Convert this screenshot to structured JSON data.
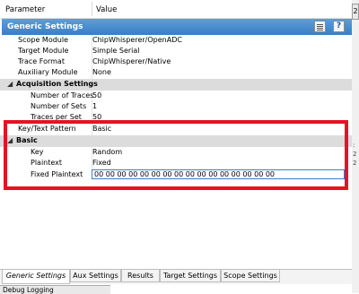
{
  "columns": {
    "parameter": "Parameter",
    "value": "Value"
  },
  "group": {
    "title": "Generic Settings"
  },
  "generic_rows": [
    {
      "key": "Scope Module",
      "value": "ChipWhisperer/OpenADC"
    },
    {
      "key": "Target Module",
      "value": "Simple Serial"
    },
    {
      "key": "Trace Format",
      "value": "ChipWhisperer/Native"
    },
    {
      "key": "Auxiliary Module",
      "value": "None"
    }
  ],
  "acq_section": {
    "label": "Acquisition Settings"
  },
  "acq_rows": [
    {
      "key": "Number of Traces",
      "value": "50"
    },
    {
      "key": "Number of Sets",
      "value": "1"
    },
    {
      "key": "Traces per Set",
      "value": "50"
    }
  ],
  "keytext_row": {
    "key": "Key/Text Pattern",
    "value": "Basic"
  },
  "basic_section": {
    "label": "Basic"
  },
  "basic_rows": [
    {
      "key": "Key",
      "value": "Random"
    },
    {
      "key": "Plaintext",
      "value": "Fixed"
    }
  ],
  "fixed_row": {
    "key": "Fixed Plaintext",
    "value": "00 00 00 00 00 00 00 00 00 00 00 00 00 00 00 00"
  },
  "tabs": [
    "Generic Settings",
    "Aux Settings",
    "Results",
    "Target Settings",
    "Scope Settings"
  ],
  "active_tab": "Generic Settings",
  "debug": {
    "label": "Debug Logging"
  },
  "edge": {
    "top_glyph": "2",
    "right_chars": [
      ":",
      "2",
      "2"
    ]
  },
  "colors": {
    "group_header": "#3a7ec4",
    "highlight": "#e81123",
    "section_bg": "#dcdcdc"
  }
}
